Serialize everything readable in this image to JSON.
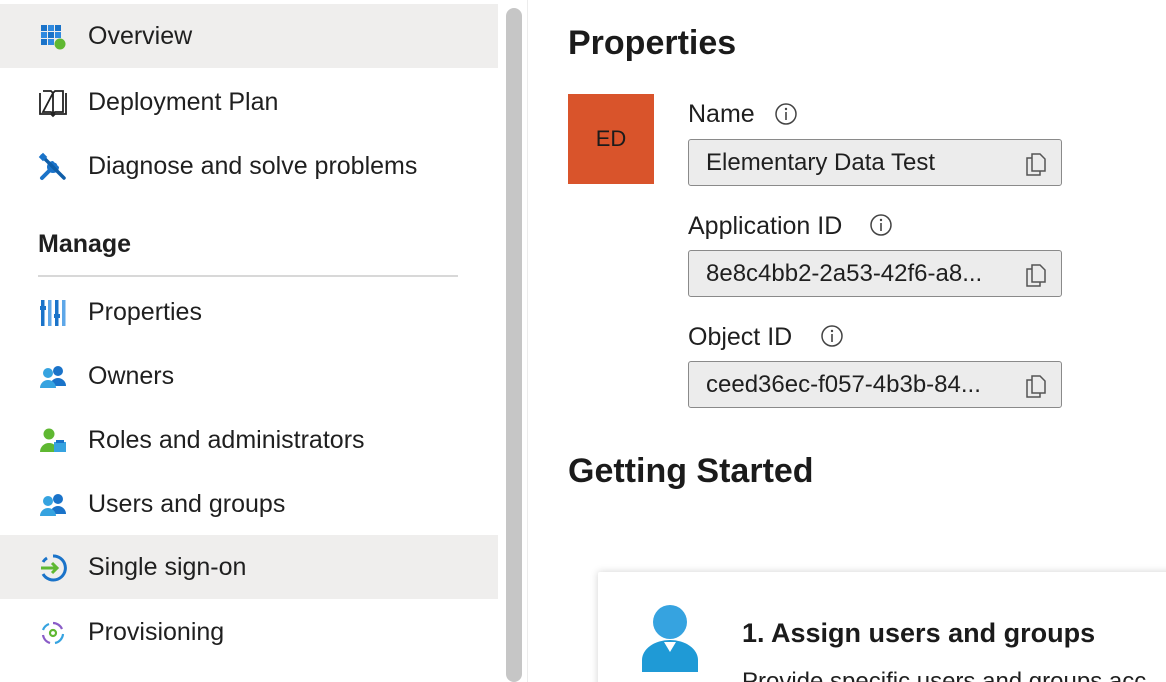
{
  "sidebar": {
    "items": [
      {
        "label": "Overview",
        "icon": "overview-grid-icon",
        "selected": true
      },
      {
        "label": "Deployment Plan",
        "icon": "book-icon",
        "selected": false
      },
      {
        "label": "Diagnose and solve problems",
        "icon": "wrench-screwdriver-icon",
        "selected": false
      }
    ],
    "manage_title": "Manage",
    "manage_items": [
      {
        "label": "Properties",
        "icon": "properties-bars-icon",
        "selected": false
      },
      {
        "label": "Owners",
        "icon": "owners-icon",
        "selected": false
      },
      {
        "label": "Roles and administrators",
        "icon": "roles-icon",
        "selected": false
      },
      {
        "label": "Users and groups",
        "icon": "users-groups-icon",
        "selected": false
      },
      {
        "label": "Single sign-on",
        "icon": "single-sign-on-icon",
        "selected": true
      },
      {
        "label": "Provisioning",
        "icon": "provisioning-icon",
        "selected": false
      }
    ]
  },
  "main": {
    "properties_title": "Properties",
    "avatar_initials": "ED",
    "avatar_color": "#d9542b",
    "fields": [
      {
        "label": "Name",
        "value": "Elementary Data Test"
      },
      {
        "label": "Application ID",
        "value": "8e8c4bb2-2a53-42f6-a8..."
      },
      {
        "label": "Object ID",
        "value": "ceed36ec-f057-4b3b-84..."
      }
    ],
    "getting_started_title": "Getting Started",
    "card": {
      "title": "1. Assign users and groups",
      "description": "Provide specific users and groups acc"
    }
  },
  "colors": {
    "accent_blue": "#0078d4",
    "selected_bg": "#efeeed"
  }
}
